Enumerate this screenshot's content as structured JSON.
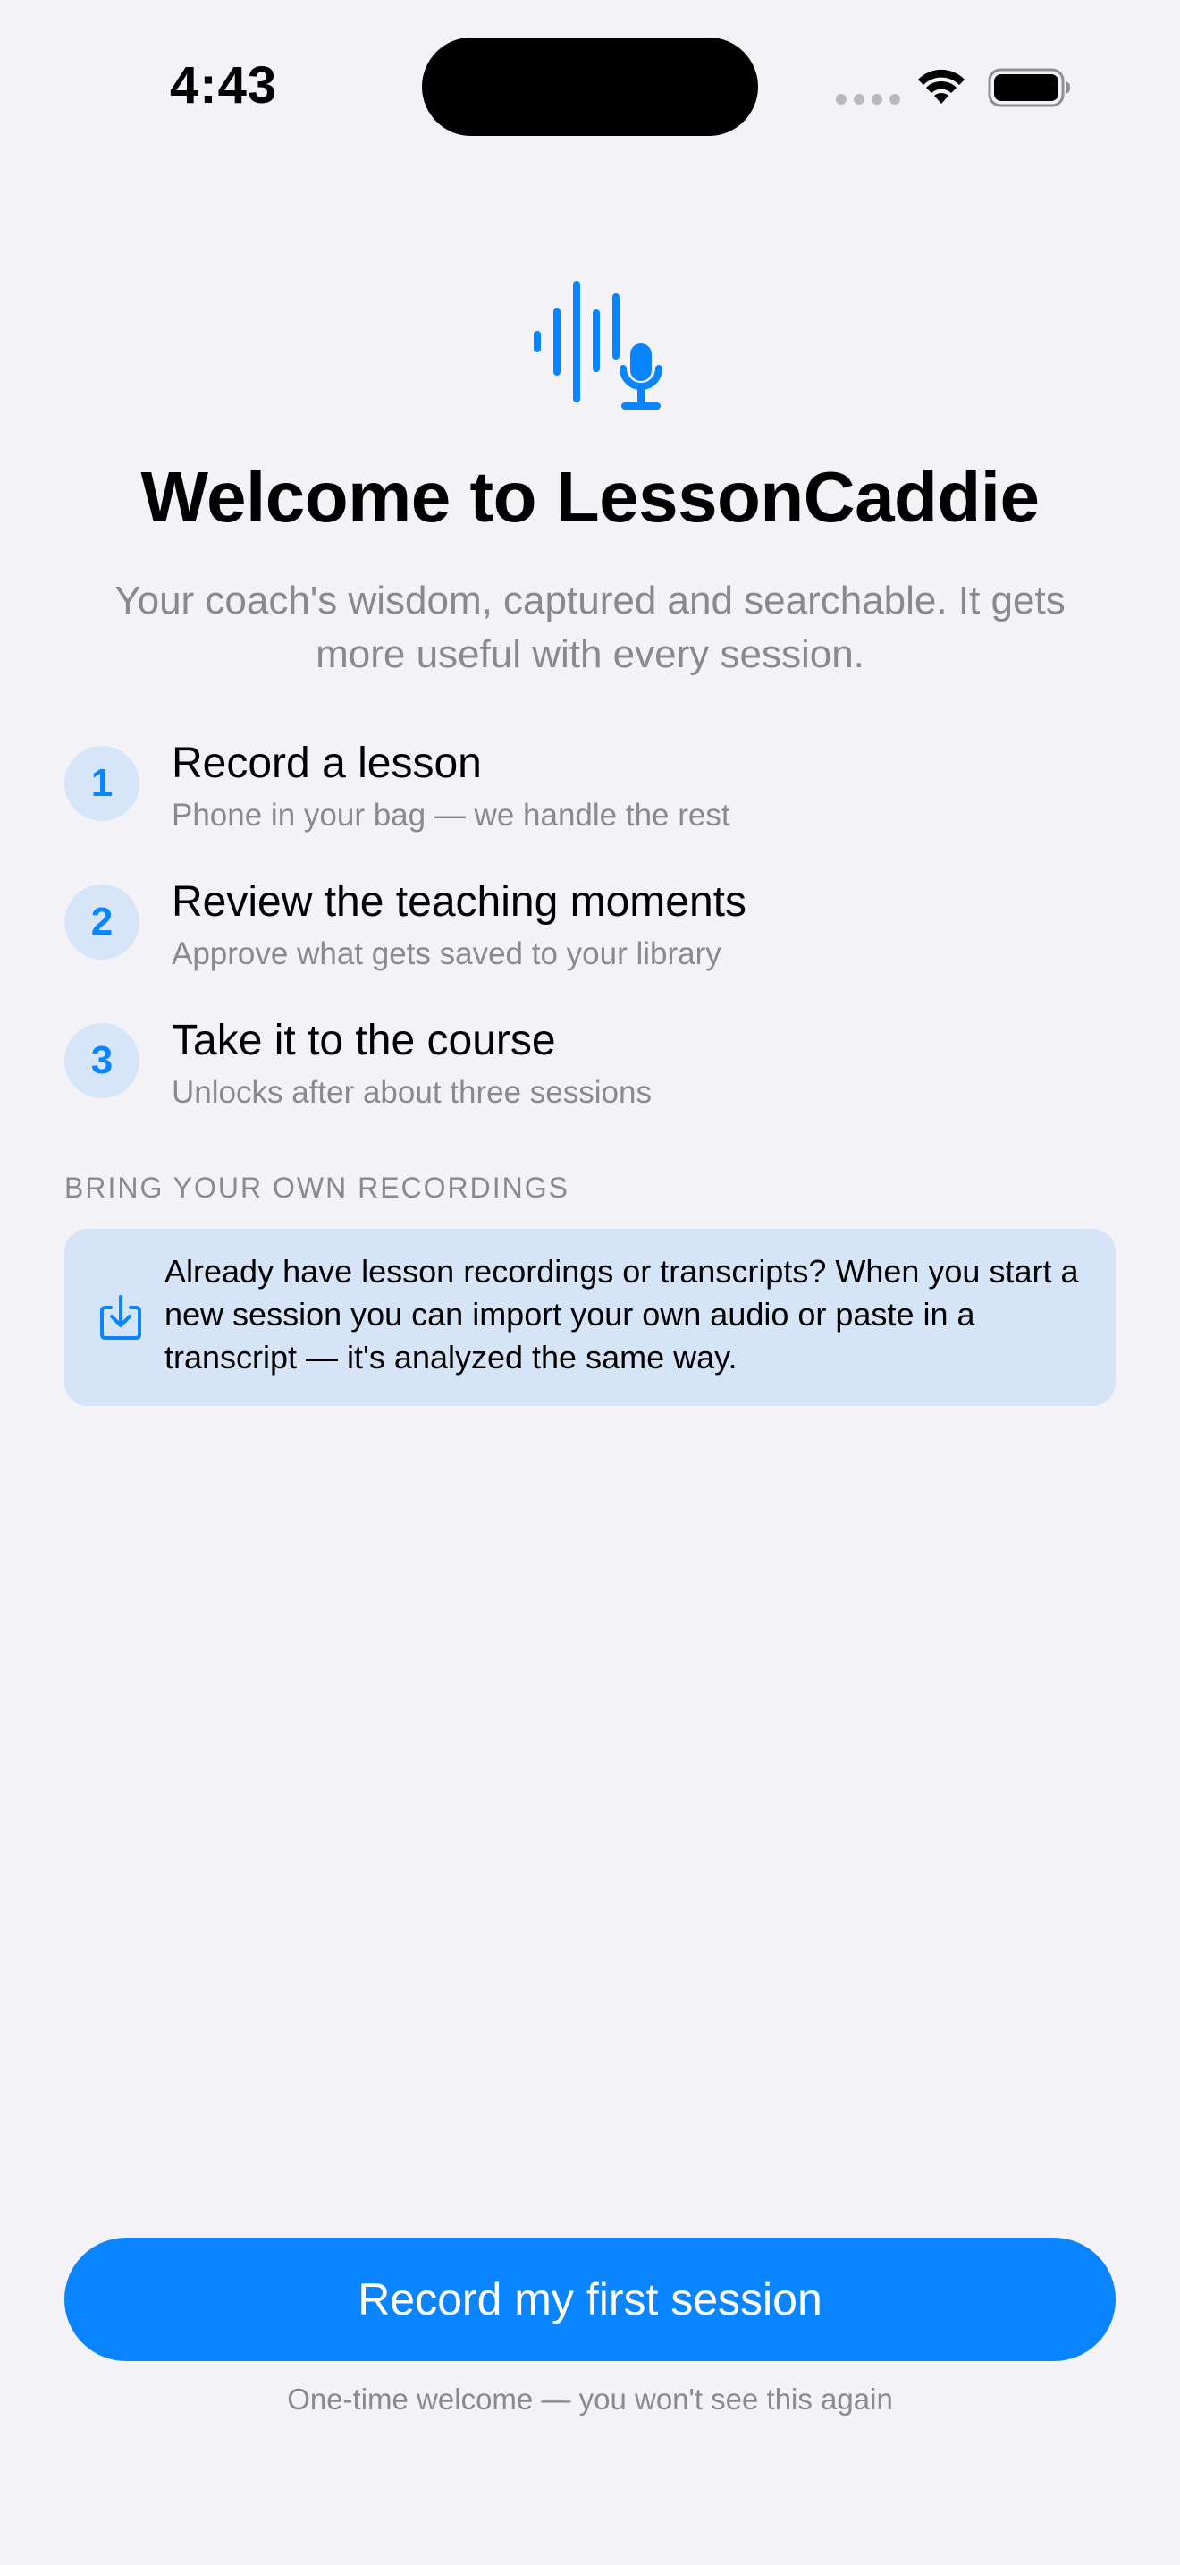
{
  "status_bar": {
    "time": "4:43",
    "icons": [
      "cellular-signal-icon",
      "wifi-icon",
      "battery-icon"
    ]
  },
  "hero": {
    "icon": "waveform-microphone-icon",
    "title": "Welcome to LessonCaddie",
    "subtitle": "Your coach's wisdom, captured and searchable. It gets more useful with every session."
  },
  "steps": [
    {
      "number": "1",
      "title": "Record a lesson",
      "subtitle": "Phone in your bag — we handle the rest"
    },
    {
      "number": "2",
      "title": "Review the teaching moments",
      "subtitle": "Approve what gets saved to your library"
    },
    {
      "number": "3",
      "title": "Take it to the course",
      "subtitle": "Unlocks after about three sessions"
    }
  ],
  "byo": {
    "header": "BRING YOUR OWN RECORDINGS",
    "icon": "import-icon",
    "text": "Already have lesson recordings or transcripts? When you start a new session you can import your own audio or paste in a transcript — it's analyzed the same way."
  },
  "cta": {
    "label": "Record my first session",
    "footnote": "One-time welcome — you won't see this again"
  },
  "colors": {
    "accent": "#0A84FF",
    "background": "#F2F2F7",
    "secondary_text": "#8A8A8E",
    "badge_bg": "#D6E6F8",
    "card_bg": "#D5E5F7"
  }
}
